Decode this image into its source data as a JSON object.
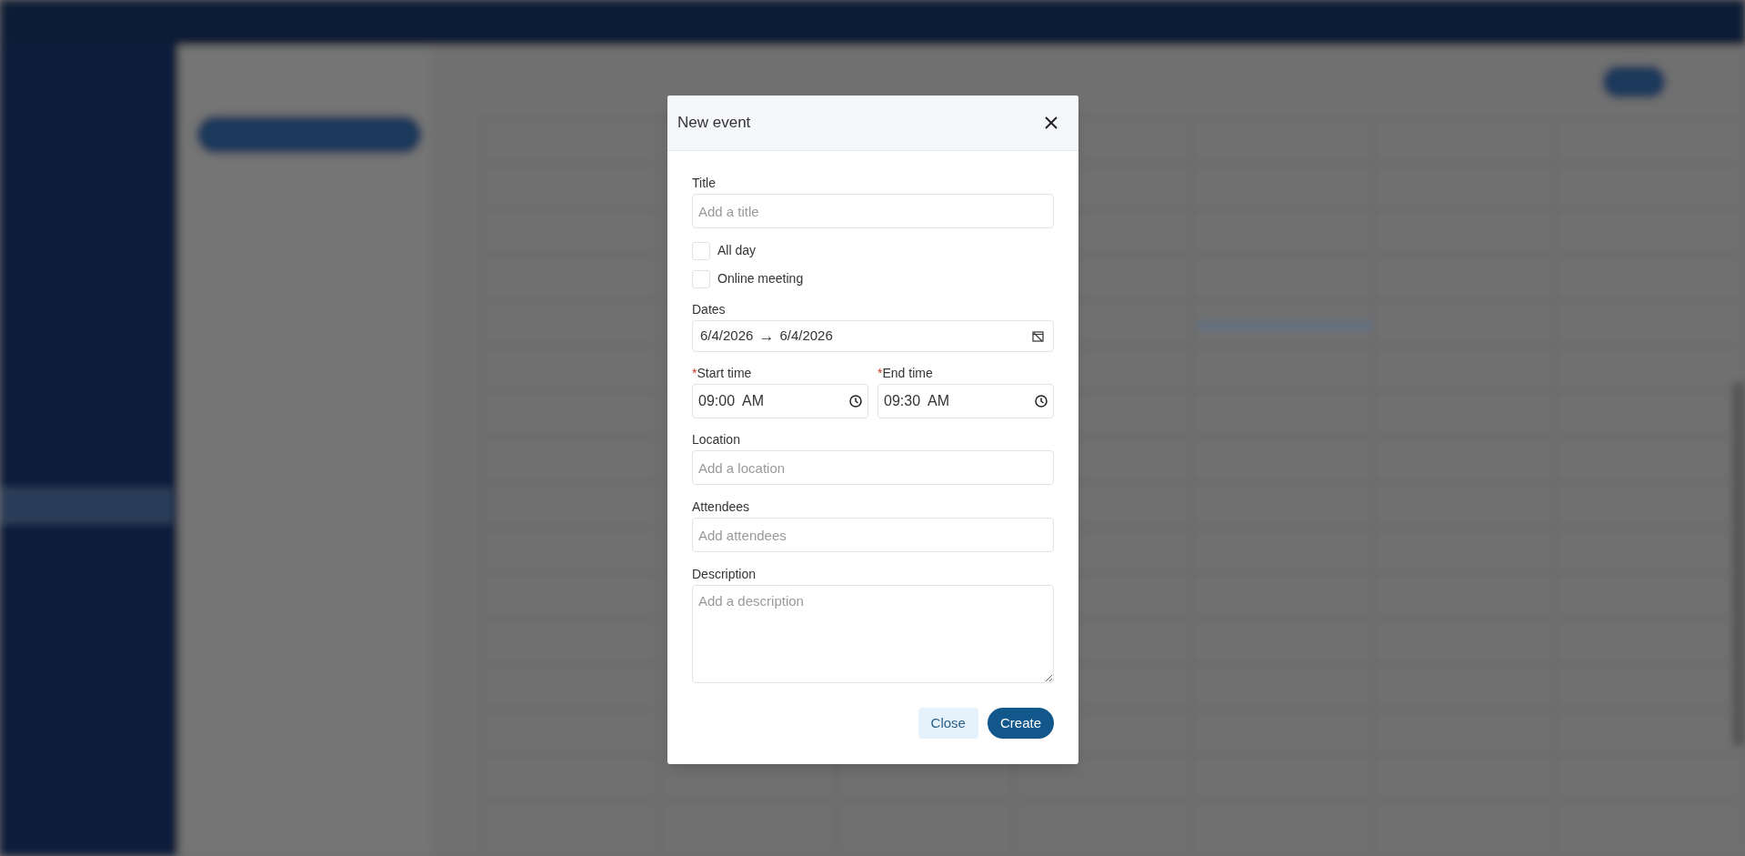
{
  "dialog": {
    "title": "New event",
    "fields": [
      {
        "kind": "text",
        "label": "Title",
        "placeholder": "Add a title"
      },
      {
        "kind": "checkbox",
        "label": "All day",
        "checked": false
      },
      {
        "kind": "checkbox",
        "label": "Online meeting",
        "checked": false
      },
      {
        "kind": "daterange",
        "label": "Dates",
        "start": "6/4/2026",
        "arrow": "→",
        "end": "6/4/2026"
      },
      {
        "kind": "timepair",
        "items": [
          {
            "label": "Start time",
            "marker": "*",
            "value": "09:00  AM"
          },
          {
            "label": "End time",
            "marker": "*",
            "value": "09:30  AM"
          }
        ]
      },
      {
        "kind": "text",
        "label": "Location",
        "placeholder": "Add a location"
      },
      {
        "kind": "text",
        "label": "Attendees",
        "placeholder": "Add attendees"
      },
      {
        "kind": "textarea",
        "label": "Description",
        "placeholder": "Add a description"
      }
    ],
    "buttons": [
      {
        "kind": "secondary",
        "label": "Close"
      },
      {
        "kind": "primary",
        "label": "Create"
      }
    ]
  }
}
